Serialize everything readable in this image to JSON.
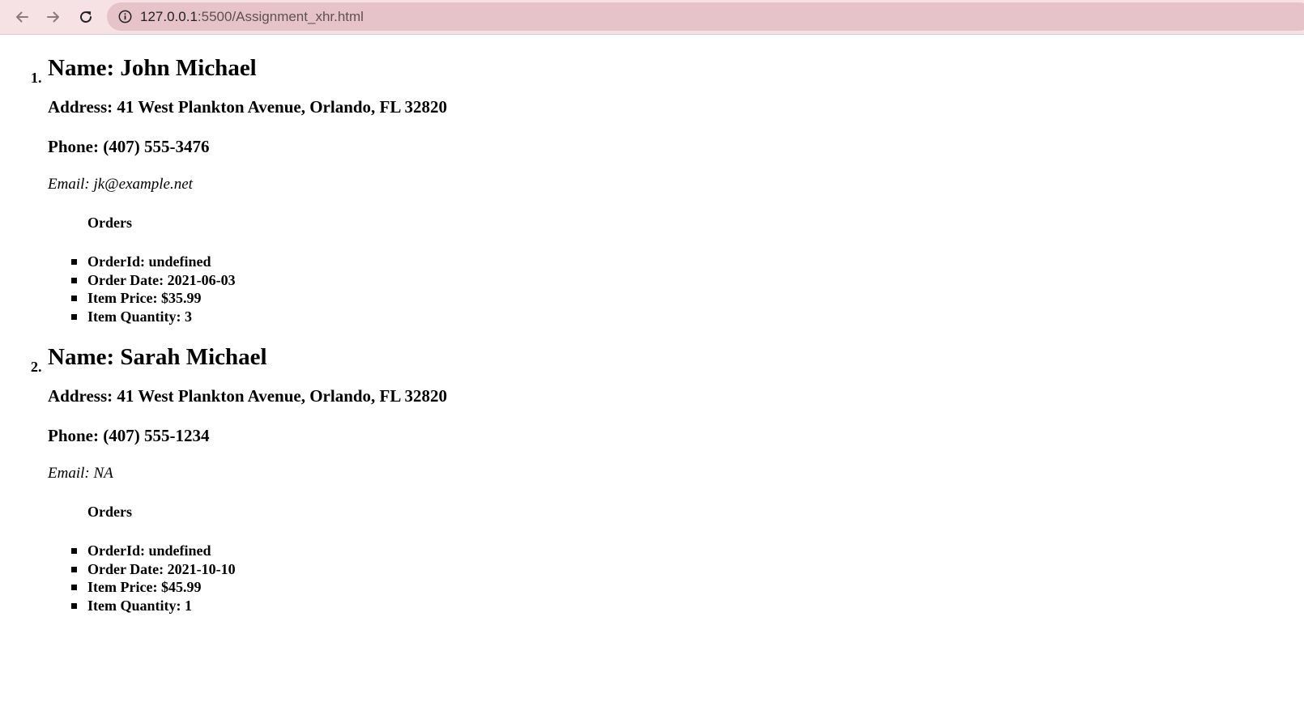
{
  "browser": {
    "url_host": "127.0.0.1",
    "url_path": ":5500/Assignment_xhr.html",
    "toolbar_color": "#f6e1e4",
    "omnibox_color": "#e6c3c9",
    "icons": [
      "back-arrow-icon",
      "forward-arrow-icon",
      "reload-icon",
      "info-icon"
    ]
  },
  "customers": [
    {
      "number": "1.",
      "name": "Name: John Michael",
      "address": "Address: 41 West Plankton Avenue, Orlando, FL 32820",
      "phone": "Phone: (407) 555-3476",
      "email": "Email: jk@example.net",
      "orders_title": "Orders",
      "orders": [
        "OrderId: undefined",
        "Order Date: 2021-06-03",
        "Item Price: $35.99",
        "Item Quantity: 3"
      ]
    },
    {
      "number": "2.",
      "name": "Name: Sarah Michael",
      "address": "Address: 41 West Plankton Avenue, Orlando, FL 32820",
      "phone": "Phone: (407) 555-1234",
      "email": "Email: NA",
      "orders_title": "Orders",
      "orders": [
        "OrderId: undefined",
        "Order Date: 2021-10-10",
        "Item Price: $45.99",
        "Item Quantity: 1"
      ]
    }
  ]
}
